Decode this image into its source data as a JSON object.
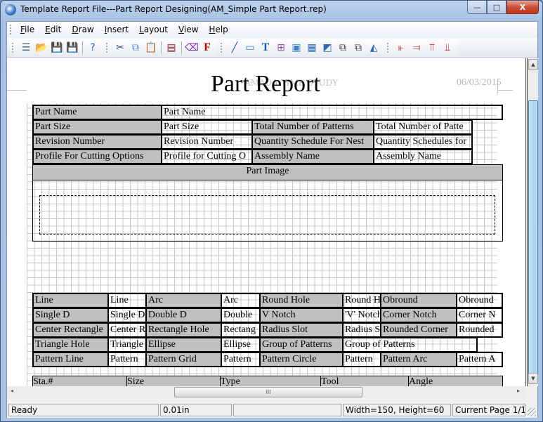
{
  "window": {
    "title": "Template Report File---Part Report Designing(AM_Simple Part Report.rep)",
    "controls": {
      "minimize": "—",
      "maximize": "□",
      "close": "X"
    }
  },
  "menubar": {
    "items": [
      {
        "label": "File",
        "accel": "F",
        "rest": "ile"
      },
      {
        "label": "Edit",
        "accel": "E",
        "rest": "dit"
      },
      {
        "label": "Draw",
        "accel": "D",
        "rest": "raw"
      },
      {
        "label": "Insert",
        "accel": "I",
        "rest": "nsert"
      },
      {
        "label": "Layout",
        "accel": "L",
        "rest": "ayout"
      },
      {
        "label": "View",
        "accel": "V",
        "rest": "iew"
      },
      {
        "label": "Help",
        "accel": "H",
        "rest": "elp"
      }
    ]
  },
  "toolbar": {
    "groups": [
      [
        {
          "name": "new-icon",
          "glyph": "☰",
          "color": "#3b5d7a"
        },
        {
          "name": "open-folder-icon",
          "glyph": "📂",
          "color": "#e0b040"
        },
        {
          "name": "save-icon",
          "glyph": "💾",
          "color": "#2a6cb8"
        },
        {
          "name": "save-as-icon",
          "glyph": "💾",
          "color": "#c8b030"
        },
        {
          "sep": true
        },
        {
          "name": "help-icon",
          "glyph": "?",
          "color": "#2d62b8"
        }
      ],
      [
        {
          "name": "cut-icon",
          "glyph": "✂",
          "color": "#2a4a80"
        },
        {
          "name": "copy-icon",
          "glyph": "⧉",
          "color": "#4a8ad0"
        },
        {
          "name": "paste-icon",
          "glyph": "📋",
          "color": "#c8a040"
        },
        {
          "sep": true
        },
        {
          "name": "page-setup-icon",
          "glyph": "▤",
          "color": "#8a1a1a"
        },
        {
          "sep": true
        },
        {
          "name": "eraser-icon",
          "glyph": "⌫",
          "color": "#7a2aa0"
        },
        {
          "name": "font-icon",
          "glyph": "F",
          "color": "#b00000"
        }
      ],
      [
        {
          "name": "line-tool-icon",
          "glyph": "╱",
          "color": "#2a5aa8"
        },
        {
          "name": "rectangle-tool-icon",
          "glyph": "▭",
          "color": "#3a80c8"
        },
        {
          "name": "text-tool-icon",
          "glyph": "T",
          "color": "#1a5ab0"
        },
        {
          "name": "field-tool-icon",
          "glyph": "⊞",
          "color": "#a050a0"
        },
        {
          "name": "label-box-icon",
          "glyph": "▣",
          "color": "#3a80c8"
        },
        {
          "name": "table-tool-icon",
          "glyph": "▦",
          "color": "#2a6ab0"
        },
        {
          "name": "image-tool-icon",
          "glyph": "◩",
          "color": "#2a6ab0"
        },
        {
          "name": "bring-front-icon",
          "glyph": "⧉",
          "color": "#333"
        },
        {
          "name": "send-back-icon",
          "glyph": "⧉",
          "color": "#333"
        },
        {
          "name": "chart-tool-icon",
          "glyph": "◭",
          "color": "#2a6ab0"
        }
      ],
      [
        {
          "name": "align-left-icon",
          "glyph": "⫦",
          "color": "#b01010"
        },
        {
          "name": "align-right-icon",
          "glyph": "⫤",
          "color": "#b01010"
        },
        {
          "name": "align-top-icon",
          "glyph": "⫪",
          "color": "#b01010"
        },
        {
          "name": "align-bottom-icon",
          "glyph": "⫫",
          "color": "#b01010"
        }
      ]
    ]
  },
  "report": {
    "watermark": "AMADA TIME STUDY",
    "title": "Part Report",
    "date": "06/03/2015",
    "header_rows": [
      {
        "label": "Part Name",
        "value": "Part Name"
      },
      {
        "label": "Part Size",
        "value": "Part Size",
        "label2": "Total Number of Patterns",
        "value2": "Total Number of Patte"
      },
      {
        "label": "Revision Number",
        "value": "Revision Number",
        "label2": "Quantity Schedule For Nest",
        "value2": "Quantity Schedules for"
      },
      {
        "label": "Profile For Cutting Options",
        "value": "Profile for Cutting O",
        "label2": "Assembly Name",
        "value2": "Assembly Name"
      }
    ],
    "part_image_label": "Part Image",
    "patterns": [
      [
        [
          "Line",
          "Line"
        ],
        [
          "Arc",
          "Arc"
        ],
        [
          "Round Hole",
          "Round H"
        ],
        [
          "Obround",
          "Obround"
        ]
      ],
      [
        [
          "Single D",
          "Single D"
        ],
        [
          "Double D",
          "Double"
        ],
        [
          "V Notch",
          "'V' Notch"
        ],
        [
          "Corner Notch",
          "Corner N"
        ]
      ],
      [
        [
          "Center Rectangle",
          "Center R"
        ],
        [
          "Rectangle Hole",
          "Rectang"
        ],
        [
          "Radius Slot",
          "Radius S"
        ],
        [
          "Rounded Corner",
          "Rounded"
        ]
      ],
      [
        [
          "Triangle Hole",
          "Triangle"
        ],
        [
          "Ellipse",
          "Ellipse"
        ],
        [
          "Group of Patterns",
          "Group of Patterns"
        ]
      ],
      [
        [
          "Pattern Line",
          "Pattern"
        ],
        [
          "Pattern Grid",
          "Pattern"
        ],
        [
          "Pattern Circle",
          "Pattern"
        ],
        [
          "Pattern Arc",
          "Pattern A"
        ]
      ]
    ],
    "station_table": {
      "columns": [
        "Sta.#",
        "Size",
        "Type",
        "Tool",
        "Angle"
      ]
    }
  },
  "statusbar": {
    "ready": "Ready",
    "unit": "0.01in",
    "blank": "",
    "dimensions": "Width=150, Height=60",
    "page": "Current Page 1/1"
  },
  "scroll": {
    "h_thumb_grip": "III",
    "left_arrow": "◂",
    "right_arrow": "▸",
    "up_arrow": "▲",
    "down_arrow": "▼"
  }
}
